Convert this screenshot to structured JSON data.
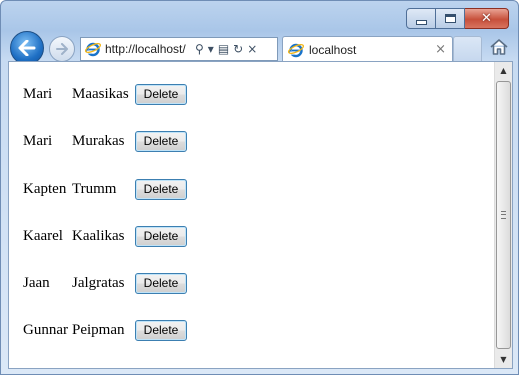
{
  "browser": {
    "address": "http://localhost/",
    "tab_title": "localhost",
    "tab_close_glyph": "×",
    "search_glyph": "⚲",
    "dropdown_glyph": "▾",
    "refresh_glyph": "↻",
    "stop_glyph": "×",
    "compat_glyph": "▤",
    "close_glyph": "✕",
    "icons": [
      "back-arrow-icon",
      "forward-arrow-icon",
      "ie-logo-icon",
      "search-icon",
      "compatibility-icon",
      "refresh-icon",
      "stop-icon",
      "home-icon",
      "minimize-icon",
      "maximize-icon",
      "close-icon"
    ]
  },
  "people": [
    {
      "first": "Mari",
      "last": "Maasikas",
      "action": "Delete"
    },
    {
      "first": "Mari",
      "last": "Murakas",
      "action": "Delete"
    },
    {
      "first": "Kapten",
      "last": "Trumm",
      "action": "Delete"
    },
    {
      "first": "Kaarel",
      "last": "Kaalikas",
      "action": "Delete"
    },
    {
      "first": "Jaan",
      "last": "Jalgratas",
      "action": "Delete"
    },
    {
      "first": "Gunnar",
      "last": "Peipman",
      "action": "Delete"
    }
  ],
  "scrollbar": {
    "up_glyph": "▲",
    "down_glyph": "▼"
  },
  "colors": {
    "titlebar": "#bcd3ee",
    "button_border": "#3c7fb1",
    "close_button": "#c7503b"
  }
}
